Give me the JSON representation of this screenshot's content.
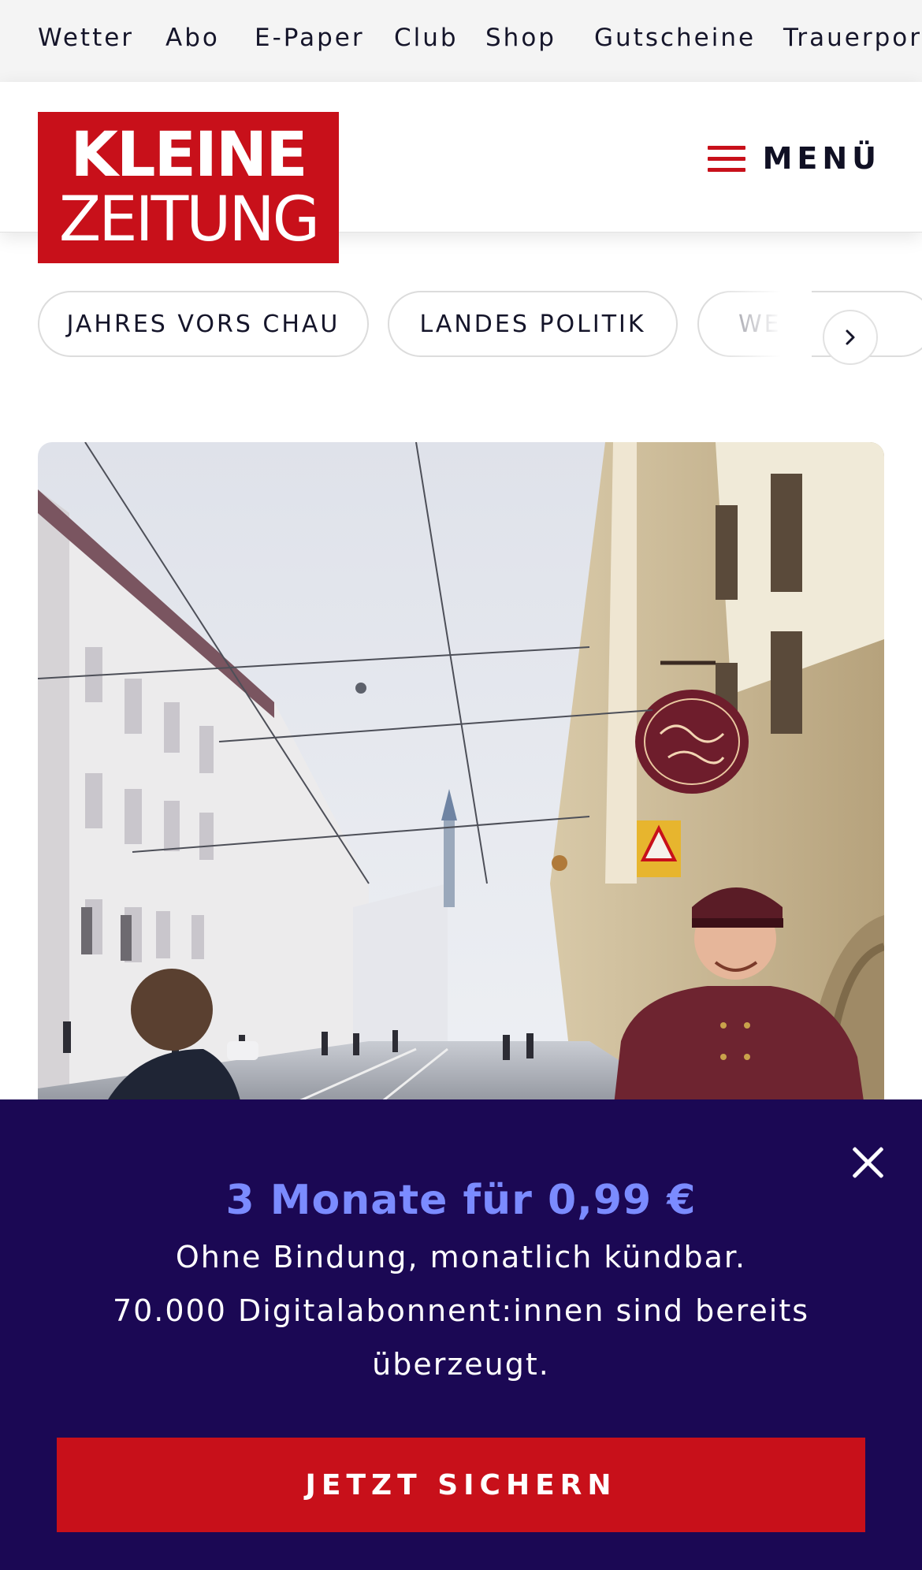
{
  "topnav": {
    "items": [
      "Wetter",
      "Abo",
      "E-Paper",
      "Club",
      "Shop",
      "Gutscheine",
      "Trauerportal"
    ]
  },
  "header": {
    "logo_line1": "KLEINE",
    "logo_line2": "ZEITUNG",
    "menu_label": "MENÜ"
  },
  "topics": {
    "chips": [
      "JAHRES VORS CHAU",
      "LANDES POLITIK",
      "WE"
    ]
  },
  "paywall": {
    "title": "3 Monate für 0,99 €",
    "line1": "Ohne Bindung, monatlich kündbar.",
    "line2": "70.000 Digitalabonnent:innen sind bereits",
    "line3": "überzeugt.",
    "cta": "JETZT SICHERN"
  },
  "colors": {
    "brand_red": "#c8101a",
    "paywall_bg": "#1b0854",
    "paywall_title": "#7b8bff"
  },
  "icons": [
    "hamburger-icon",
    "chevron-right-icon",
    "close-icon"
  ]
}
